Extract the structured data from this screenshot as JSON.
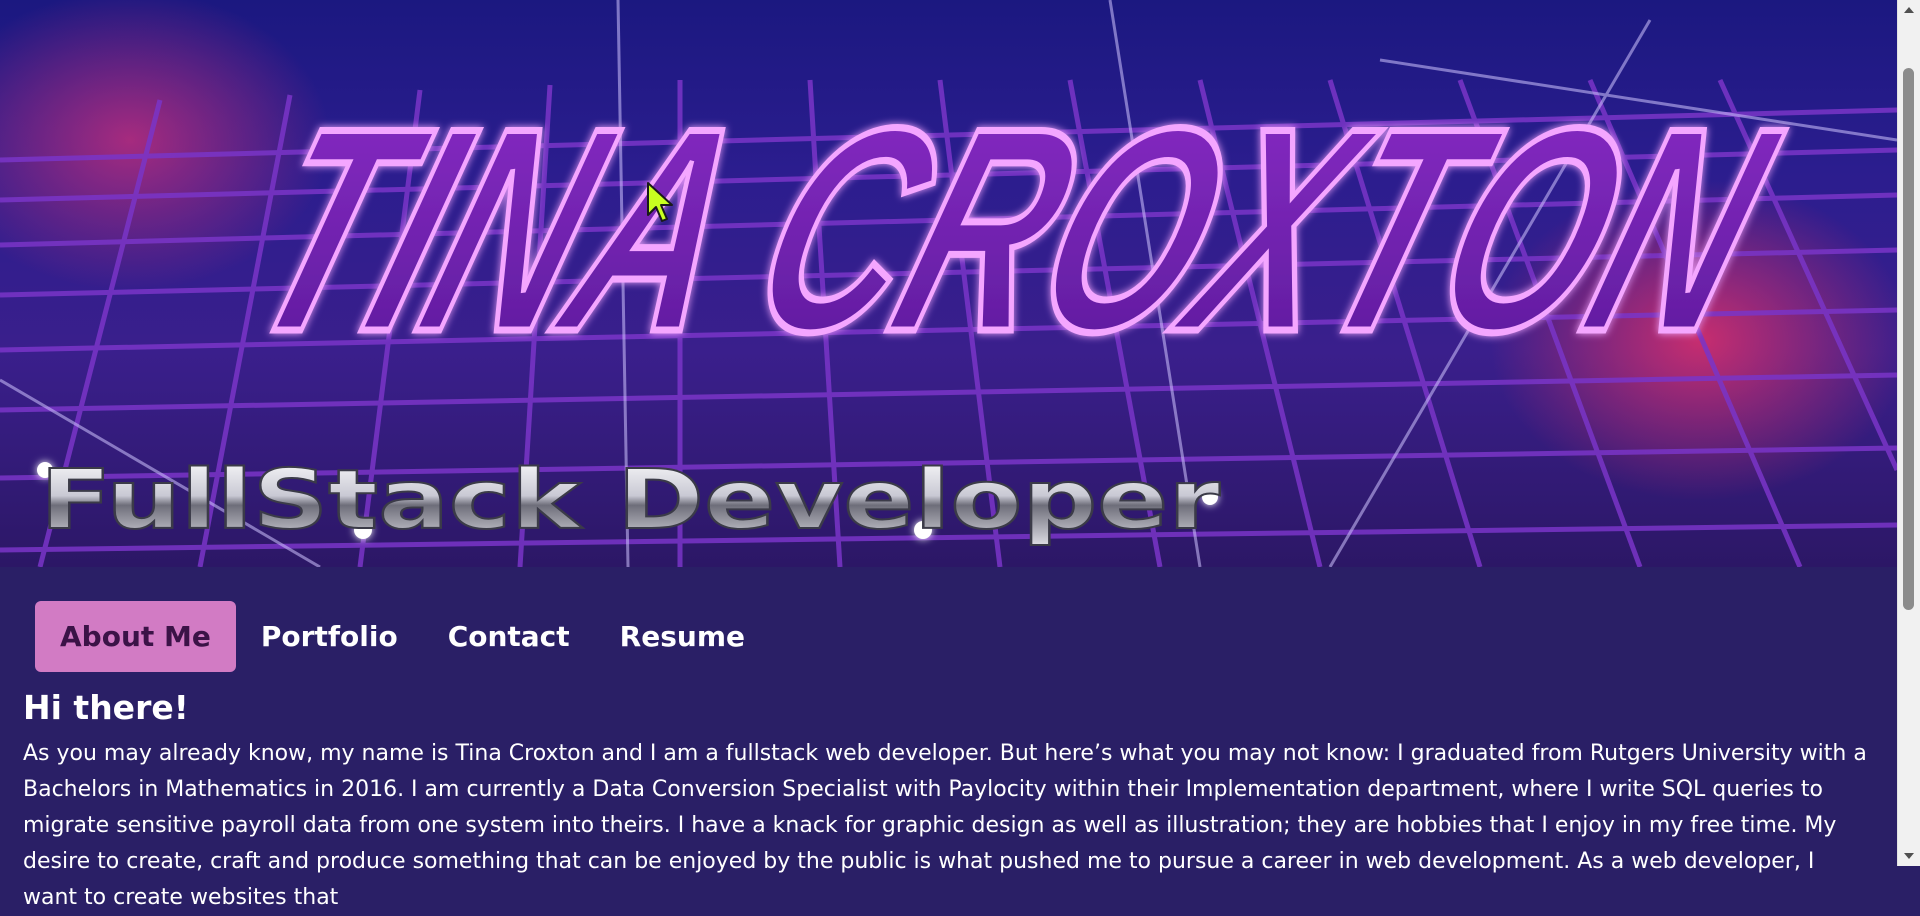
{
  "banner": {
    "name_art": "TINA CROXTON",
    "subtitle": "FullStack Developer"
  },
  "nav": {
    "items": [
      {
        "label": "About Me",
        "active": true
      },
      {
        "label": "Portfolio",
        "active": false
      },
      {
        "label": "Contact",
        "active": false
      },
      {
        "label": "Resume",
        "active": false
      }
    ]
  },
  "about": {
    "heading": "Hi there!",
    "text": "As you may already know, my name is Tina Croxton and I am a fullstack web developer. But here’s what you may not know: I graduated from Rutgers University with a Bachelors in Mathematics in 2016. I am currently a Data Conversion Specialist with Paylocity within their Implementation department, where I write SQL queries to migrate sensitive payroll data from one system into theirs. I have a knack for graphic design as well as illustration; they are hobbies that I enjoy in my free time. My desire to create, craft and produce something that can be enjoyed by the public is what pushed me to pursue a career in web development. As a web developer, I want to create websites that"
  },
  "colors": {
    "page_bg": "#2a1f66",
    "active_tab_bg": "#d27bc4",
    "active_tab_text": "#3b1347",
    "neon_purple": "#c04ff0",
    "grid": "#7a35c8"
  },
  "icons": {
    "cursor": "arrow-pointer-icon"
  }
}
